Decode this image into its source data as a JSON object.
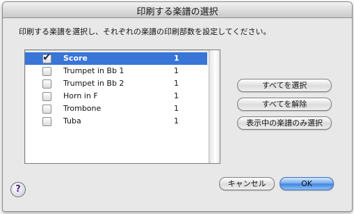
{
  "dialog": {
    "title": "印刷する楽譜の選択",
    "instruction": "印刷する楽譜を選択し、それぞれの楽譜の印刷部数を設定してください。"
  },
  "parts": [
    {
      "name": "Score",
      "copies": "1",
      "checked": true,
      "selected": true
    },
    {
      "name": "Trumpet in Bb 1",
      "copies": "1",
      "checked": false,
      "selected": false
    },
    {
      "name": "Trumpet in Bb 2",
      "copies": "1",
      "checked": false,
      "selected": false
    },
    {
      "name": "Horn in F",
      "copies": "1",
      "checked": false,
      "selected": false
    },
    {
      "name": "Trombone",
      "copies": "1",
      "checked": false,
      "selected": false
    },
    {
      "name": "Tuba",
      "copies": "1",
      "checked": false,
      "selected": false
    }
  ],
  "buttons": {
    "select_all": "すべてを選択",
    "deselect_all": "すべてを解除",
    "select_visible": "表示中の楽譜のみ選択",
    "cancel": "キャンセル",
    "ok": "OK"
  },
  "help": {
    "symbol": "?"
  },
  "colors": {
    "selection": "#3875d7",
    "default_button": "#4a8fe3"
  },
  "icons": {
    "check": "check-icon",
    "help": "help-icon"
  }
}
